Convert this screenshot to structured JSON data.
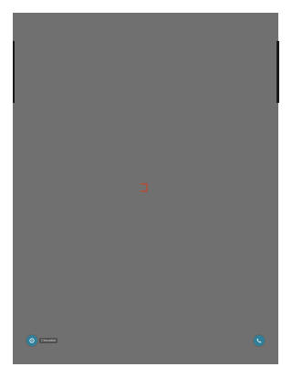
{
  "help": {
    "label": "Checklist",
    "icon": "help-icon"
  },
  "call": {
    "icon": "phone-icon"
  },
  "loading": {
    "icon": "bracket-icon",
    "color": "#c2452d"
  },
  "colors": {
    "page_background": "#707070",
    "accent": "#2f7f9a",
    "side_bars": "#1a1a1a"
  }
}
